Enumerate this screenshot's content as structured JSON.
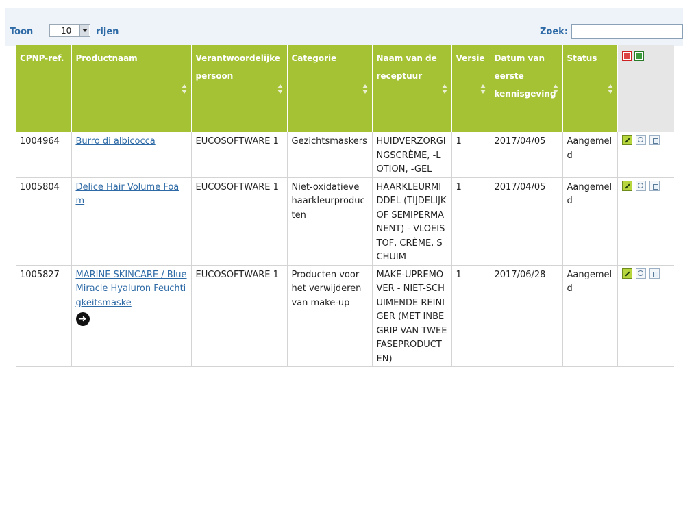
{
  "controls": {
    "show_label": "Toon",
    "page_size": "10",
    "rows_label": "rijen",
    "search_label": "Zoek:",
    "search_value": ""
  },
  "table": {
    "headers": {
      "ref": "CPNP-ref.",
      "name": "Productnaam",
      "person": "Verantwoordelijke persoon",
      "category": "Categorie",
      "frame": "Naam van de receptuur",
      "version": "Versie",
      "date": "Datum van eerste kennisgeving",
      "status": "Status"
    },
    "rows": [
      {
        "ref": "1004964",
        "name": "Burro di albicocca",
        "person": "EUCOSOFTWARE 1",
        "category": "Gezichtsmaskers",
        "frame": "HUIDVERZORGINGSCRÈME, -LOTION, -GEL",
        "version": "1",
        "date": "2017/04/05",
        "status": "Aangemeld"
      },
      {
        "ref": "1005804",
        "name": "Delice Hair Volume Foam",
        "person": "EUCOSOFTWARE 1",
        "category": "Niet-oxidatieve haarkleurproducten",
        "frame": "HAARKLEURMIDDEL (TIJDELIJK OF SEMIPERMANENT) - VLOEISTOF, CRÈME, SCHUIM",
        "version": "1",
        "date": "2017/04/05",
        "status": "Aangemeld"
      },
      {
        "ref": "1005827",
        "name": "MARINE SKINCARE / BlueMiracle Hyaluron Feuchtigkeitsmaske",
        "person": "EUCOSOFTWARE 1",
        "category": "Producten voor het verwijderen van make-up",
        "frame": "MAKE-UPREMOVER - NIET-SCHUIMENDE REINIGER (MET INBEGRIP VAN TWEEFASEPRODUCTEN)",
        "version": "1",
        "date": "2017/06/28",
        "status": "Aangemeld"
      }
    ]
  },
  "colors": {
    "header_bg": "#a5c235",
    "link": "#2e6aa6",
    "topbar_bg": "#eef3f9"
  },
  "icons": {
    "export": [
      "pdf-icon",
      "excel-icon"
    ],
    "row_actions": [
      "edit-icon",
      "view-icon",
      "copy-icon"
    ],
    "special": "exit-icon"
  }
}
